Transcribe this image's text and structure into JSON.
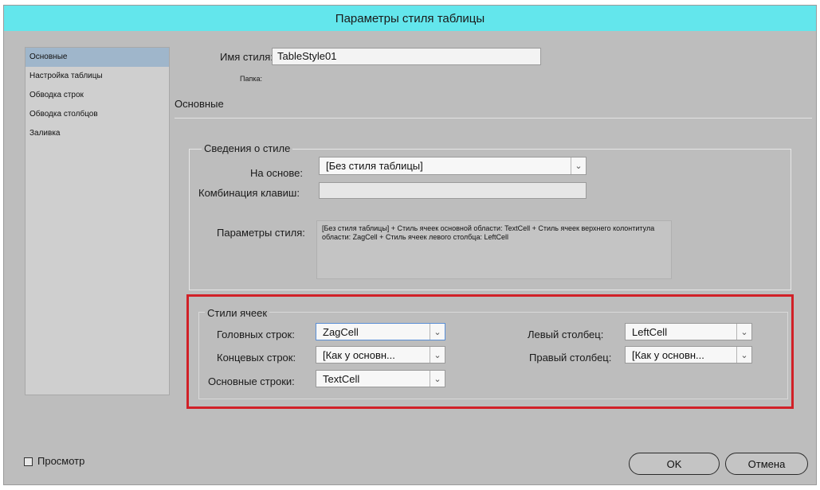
{
  "window": {
    "title": "Параметры стиля таблицы"
  },
  "sidebar": {
    "items": [
      {
        "label": "Основные",
        "active": true
      },
      {
        "label": "Настройка таблицы"
      },
      {
        "label": "Обводка строк"
      },
      {
        "label": "Обводка столбцов"
      },
      {
        "label": "Заливка"
      }
    ]
  },
  "header": {
    "style_name_label": "Имя стиля:",
    "style_name_value": "TableStyle01",
    "folder_label": "Папка:",
    "section_title": "Основные"
  },
  "style_info": {
    "legend": "Сведения о стиле",
    "based_on_label": "На основе:",
    "based_on_value": "[Без стиля таблицы]",
    "shortcut_label": "Комбинация клавиш:",
    "shortcut_value": "",
    "settings_label": "Параметры стиля:",
    "settings_text": "[Без стиля таблицы] + Стиль ячеек основной области: TextCell + Стиль ячеек верхнего колонтитула области: ZagCell + Стиль ячеек левого столбца: LeftCell"
  },
  "cell_styles": {
    "legend": "Стили ячеек",
    "header_rows_label": "Головных строк:",
    "header_rows_value": "ZagCell",
    "footer_rows_label": "Концевых строк:",
    "footer_rows_value": "[Как у основн...",
    "body_rows_label": "Основные строки:",
    "body_rows_value": "TextCell",
    "left_col_label": "Левый столбец:",
    "left_col_value": "LeftCell",
    "right_col_label": "Правый столбец:",
    "right_col_value": "[Как у основн..."
  },
  "footer": {
    "preview_label": "Просмотр",
    "ok_label": "OK",
    "cancel_label": "Отмена"
  },
  "colors": {
    "titlebar": "#63e6ec",
    "dialog_bg": "#bdbdbd",
    "sidebar_active": "#9fb6cb",
    "highlight_box": "#d12027"
  },
  "icons": [
    "chevron-down-icon",
    "checkbox-icon"
  ]
}
